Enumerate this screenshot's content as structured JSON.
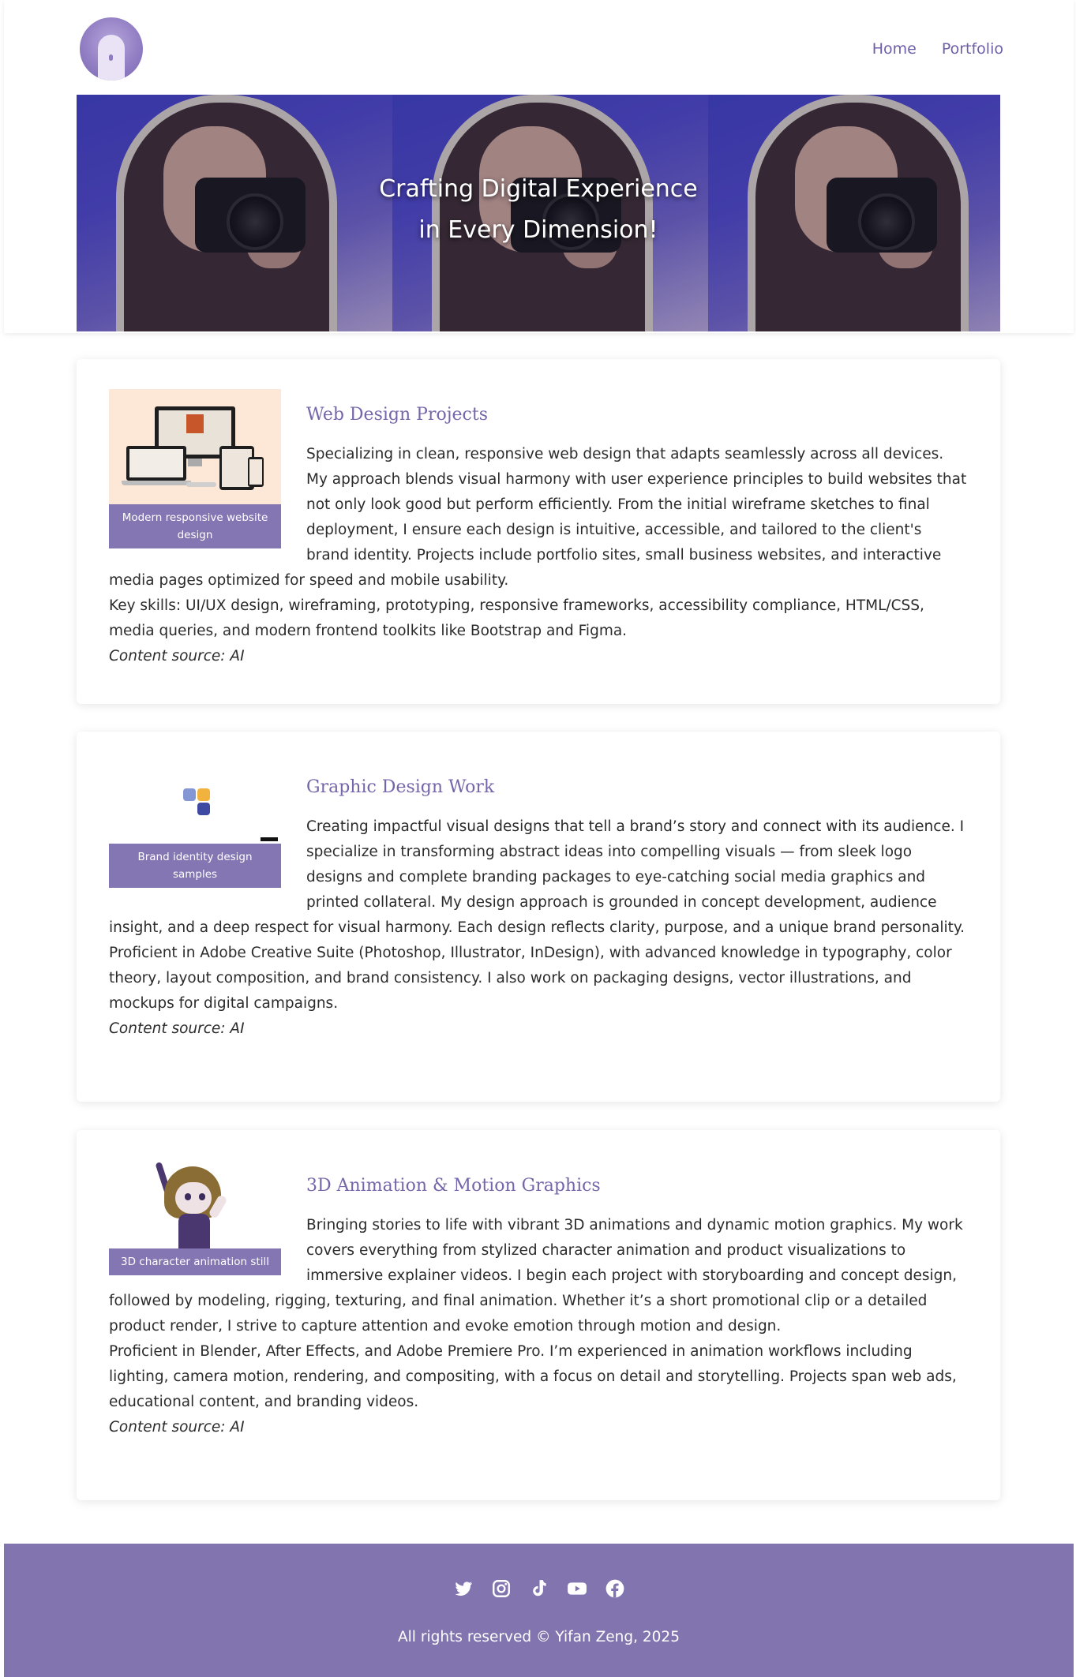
{
  "nav": {
    "items": [
      "Home",
      "Portfolio"
    ]
  },
  "hero": {
    "title_line1": "Crafting Digital Experience",
    "title_line2": "in Every Dimension!"
  },
  "cards": [
    {
      "title": "Web Design Projects",
      "caption": "Modern responsive website design",
      "p1": "Specializing in clean, responsive web design that adapts seamlessly across all devices. My approach blends visual harmony with user experience principles to build websites that not only look good but perform efficiently. From the initial wireframe sketches to final deployment, I ensure each design is intuitive, accessible, and tailored to the client's brand identity. Projects include portfolio sites, small business websites, and interactive media pages optimized for speed and mobile usability.",
      "p2": "Key skills: UI/UX design, wireframing, prototyping, responsive frameworks, accessibility compliance, HTML/CSS, media queries, and modern frontend toolkits like Bootstrap and Figma.",
      "source": "Content source: AI"
    },
    {
      "title": "Graphic Design Work",
      "caption": "Brand identity design samples",
      "p1": "Creating impactful visual designs that tell a brand’s story and connect with its audience. I specialize in transforming abstract ideas into compelling visuals — from sleek logo designs and complete branding packages to eye-catching social media graphics and printed collateral. My design approach is grounded in concept development, audience insight, and a deep respect for visual harmony. Each design reflects clarity, purpose, and a unique brand personality.",
      "p2": "Proficient in Adobe Creative Suite (Photoshop, Illustrator, InDesign), with advanced knowledge in typography, color theory, layout composition, and brand consistency. I also work on packaging designs, vector illustrations, and mockups for digital campaigns.",
      "source": "Content source: AI"
    },
    {
      "title": "3D Animation & Motion Graphics",
      "caption": "3D character animation still",
      "p1": "Bringing stories to life with vibrant 3D animations and dynamic motion graphics. My work covers everything from stylized character animation and product visualizations to immersive explainer videos. I begin each project with storyboarding and concept design, followed by modeling, rigging, texturing, and final animation. Whether it’s a short promotional clip or a detailed product render, I strive to capture attention and evoke emotion through motion and design.",
      "p2": "Proficient in Blender, After Effects, and Adobe Premiere Pro. I’m experienced in animation workflows including lighting, camera motion, rendering, and compositing, with a focus on detail and storytelling. Projects span web ads, educational content, and branding videos.",
      "source": "Content source: AI"
    }
  ],
  "footer": {
    "social_icons": [
      "twitter-icon",
      "instagram-icon",
      "tiktok-icon",
      "youtube-icon",
      "facebook-icon"
    ],
    "copyright": "All rights reserved © Yifan Zeng, 2025"
  },
  "colors": {
    "accent": "#7566aa",
    "footer_bg": "#8274ae",
    "caption_bg": "#8476b2"
  }
}
